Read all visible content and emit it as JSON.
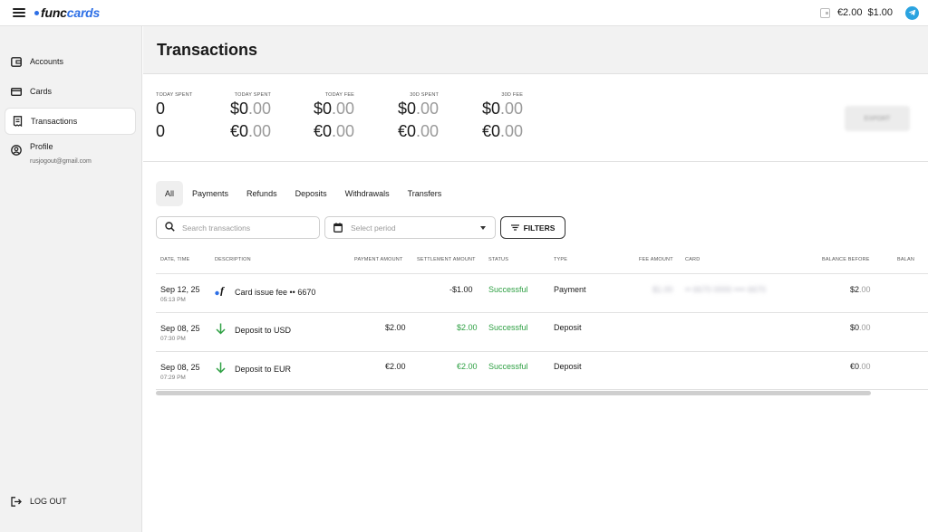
{
  "header": {
    "logo_func": "func",
    "logo_cards": "cards",
    "balance_eur": "€2.00",
    "balance_usd": "$1.00"
  },
  "sidebar": {
    "items": [
      {
        "label": "Accounts",
        "icon": "wallet-icon"
      },
      {
        "label": "Cards",
        "icon": "card-icon"
      },
      {
        "label": "Transactions",
        "icon": "receipt-icon",
        "active": true
      },
      {
        "label": "Profile",
        "icon": "user-icon"
      }
    ],
    "profile_email": "rusjogout@gmail.com",
    "logout_label": "LOG OUT"
  },
  "page": {
    "title": "Transactions"
  },
  "stats": [
    {
      "label": "TODAY SPENT",
      "usd": "0",
      "usd_dec": "",
      "eur": "0",
      "eur_dec": ""
    },
    {
      "label": "TODAY SPENT",
      "usd": "$0",
      "usd_dec": ".00",
      "eur": "€0",
      "eur_dec": ".00"
    },
    {
      "label": "TODAY FEE",
      "usd": "$0",
      "usd_dec": ".00",
      "eur": "€0",
      "eur_dec": ".00"
    },
    {
      "label": "30D SPENT",
      "usd": "$0",
      "usd_dec": ".00",
      "eur": "€0",
      "eur_dec": ".00"
    },
    {
      "label": "30D FEE",
      "usd": "$0",
      "usd_dec": ".00",
      "eur": "€0",
      "eur_dec": ".00"
    }
  ],
  "export_label": "EXPORT",
  "tabs": [
    "All",
    "Payments",
    "Refunds",
    "Deposits",
    "Withdrawals",
    "Transfers"
  ],
  "search": {
    "placeholder": "Search transactions"
  },
  "period": {
    "placeholder": "Select period"
  },
  "filters_label": "FILTERS",
  "table": {
    "columns": [
      "DATE, TIME",
      "DESCRIPTION",
      "PAYMENT AMOUNT",
      "SETTLEMENT AMOUNT",
      "STATUS",
      "TYPE",
      "FEE AMOUNT",
      "CARD",
      "BALANCE BEFORE",
      "BALAN"
    ],
    "rows": [
      {
        "date": "Sep 12, 25",
        "time": "05:13 PM",
        "icon": "funccards-f-icon",
        "description": "Card issue fee •• 6670",
        "payment": "",
        "settlement": "-$1.00",
        "status": "Successful",
        "type": "Payment",
        "fee": "$1.00",
        "card": "•• 6670 0000 •••• 6670",
        "balance_before": "$2",
        "balance_before_dec": ".00"
      },
      {
        "date": "Sep 08, 25",
        "time": "07:30 PM",
        "icon": "arrow-down-icon",
        "description": "Deposit to USD",
        "payment": "$2.00",
        "settlement": "$2.00",
        "status": "Successful",
        "type": "Deposit",
        "fee": "",
        "card": "",
        "balance_before": "$0",
        "balance_before_dec": ".00"
      },
      {
        "date": "Sep 08, 25",
        "time": "07:29 PM",
        "icon": "arrow-down-icon",
        "description": "Deposit to EUR",
        "payment": "€2.00",
        "settlement": "€2.00",
        "status": "Successful",
        "type": "Deposit",
        "fee": "",
        "card": "",
        "balance_before": "€0",
        "balance_before_dec": ".00"
      }
    ]
  },
  "colors": {
    "brand": "#2d6fe6",
    "success": "#2ea043",
    "telegram": "#2aa3e0"
  }
}
